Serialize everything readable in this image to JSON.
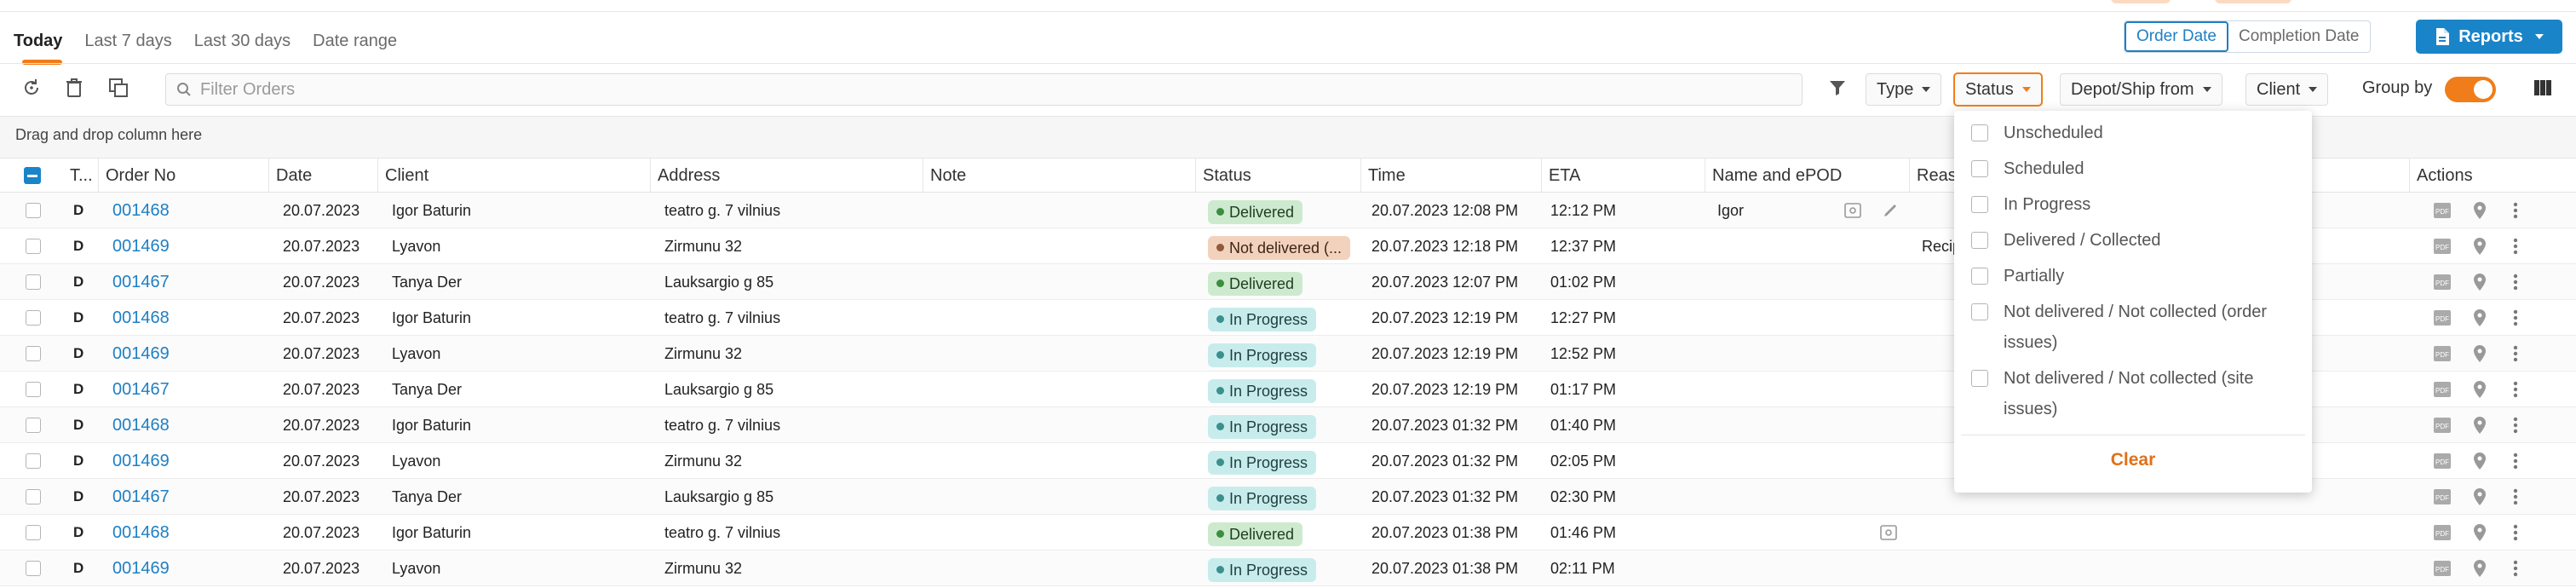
{
  "colors": {
    "accent": "#f07d1a",
    "primary": "#1a84c9",
    "link": "#1e7fc4"
  },
  "tabs": [
    "Today",
    "Last 7 days",
    "Last 30 days",
    "Date range"
  ],
  "date_toggle": {
    "order_date": "Order Date",
    "completion_date": "Completion Date",
    "selected": "Order Date"
  },
  "reports": {
    "label": "Reports",
    "icon": "document-icon"
  },
  "toolbar": {
    "search_placeholder": "Filter Orders",
    "icons": [
      "refresh-icon",
      "trash-icon",
      "copy-icon"
    ],
    "filters": [
      "Type",
      "Status",
      "Depot/Ship from",
      "Client"
    ],
    "group_by_label": "Group by",
    "group_by_on": true
  },
  "hint": "Drag and drop column here",
  "columns": [
    "T...",
    "Order No",
    "Date",
    "Client",
    "Address",
    "Note",
    "Status",
    "Time",
    "ETA",
    "Name and ePOD",
    "Reas",
    "Actions"
  ],
  "rows": [
    {
      "type": "D",
      "order": "001468",
      "date": "20.07.2023",
      "client": "Igor Baturin",
      "address": "teatro g. 7 vilnius",
      "status": "Delivered",
      "status_kind": "delivered",
      "time": "20.07.2023 12:08 PM",
      "eta": "12:12 PM",
      "epod": "Igor",
      "reason": "",
      "epod_icons": true
    },
    {
      "type": "D",
      "order": "001469",
      "date": "20.07.2023",
      "client": "Lyavon",
      "address": "Zirmunu 32",
      "status": "Not delivered (...",
      "status_kind": "notdel",
      "time": "20.07.2023 12:18 PM",
      "eta": "12:37 PM",
      "epod": "",
      "reason": "Recip",
      "epod_icons": false
    },
    {
      "type": "D",
      "order": "001467",
      "date": "20.07.2023",
      "client": "Tanya Der",
      "address": "Lauksargio g 85",
      "status": "Delivered",
      "status_kind": "delivered",
      "time": "20.07.2023 12:07 PM",
      "eta": "01:02 PM",
      "epod": "",
      "reason": "",
      "epod_icons": false
    },
    {
      "type": "D",
      "order": "001468",
      "date": "20.07.2023",
      "client": "Igor Baturin",
      "address": "teatro g. 7 vilnius",
      "status": "In Progress",
      "status_kind": "progress",
      "time": "20.07.2023 12:19 PM",
      "eta": "12:27 PM",
      "epod": "",
      "reason": "",
      "epod_icons": false
    },
    {
      "type": "D",
      "order": "001469",
      "date": "20.07.2023",
      "client": "Lyavon",
      "address": "Zirmunu 32",
      "status": "In Progress",
      "status_kind": "progress",
      "time": "20.07.2023 12:19 PM",
      "eta": "12:52 PM",
      "epod": "",
      "reason": "",
      "epod_icons": false
    },
    {
      "type": "D",
      "order": "001467",
      "date": "20.07.2023",
      "client": "Tanya Der",
      "address": "Lauksargio g 85",
      "status": "In Progress",
      "status_kind": "progress",
      "time": "20.07.2023 12:19 PM",
      "eta": "01:17 PM",
      "epod": "",
      "reason": "",
      "epod_icons": false
    },
    {
      "type": "D",
      "order": "001468",
      "date": "20.07.2023",
      "client": "Igor Baturin",
      "address": "teatro g. 7 vilnius",
      "status": "In Progress",
      "status_kind": "progress",
      "time": "20.07.2023 01:32 PM",
      "eta": "01:40 PM",
      "epod": "",
      "reason": "",
      "epod_icons": false
    },
    {
      "type": "D",
      "order": "001469",
      "date": "20.07.2023",
      "client": "Lyavon",
      "address": "Zirmunu 32",
      "status": "In Progress",
      "status_kind": "progress",
      "time": "20.07.2023 01:32 PM",
      "eta": "02:05 PM",
      "epod": "",
      "reason": "",
      "epod_icons": false
    },
    {
      "type": "D",
      "order": "001467",
      "date": "20.07.2023",
      "client": "Tanya Der",
      "address": "Lauksargio g 85",
      "status": "In Progress",
      "status_kind": "progress",
      "time": "20.07.2023 01:32 PM",
      "eta": "02:30 PM",
      "epod": "",
      "reason": "",
      "epod_icons": false
    },
    {
      "type": "D",
      "order": "001468",
      "date": "20.07.2023",
      "client": "Igor Baturin",
      "address": "teatro g. 7 vilnius",
      "status": "Delivered",
      "status_kind": "delivered",
      "time": "20.07.2023 01:38 PM",
      "eta": "01:46 PM",
      "epod": "",
      "reason": "",
      "epod_icons": "photo"
    },
    {
      "type": "D",
      "order": "001469",
      "date": "20.07.2023",
      "client": "Lyavon",
      "address": "Zirmunu 32",
      "status": "In Progress",
      "status_kind": "progress",
      "time": "20.07.2023 01:38 PM",
      "eta": "02:11 PM",
      "epod": "",
      "reason": "",
      "epod_icons": false
    }
  ],
  "row_actions": [
    "pdf-icon",
    "map-pin-icon",
    "more-vertical-icon"
  ],
  "status_dropdown": {
    "options": [
      "Unscheduled",
      "Scheduled",
      "In Progress",
      "Delivered / Collected",
      "Partially",
      "Not delivered / Not collected (order issues)",
      "Not delivered / Not collected (site issues)"
    ],
    "clear_label": "Clear"
  }
}
